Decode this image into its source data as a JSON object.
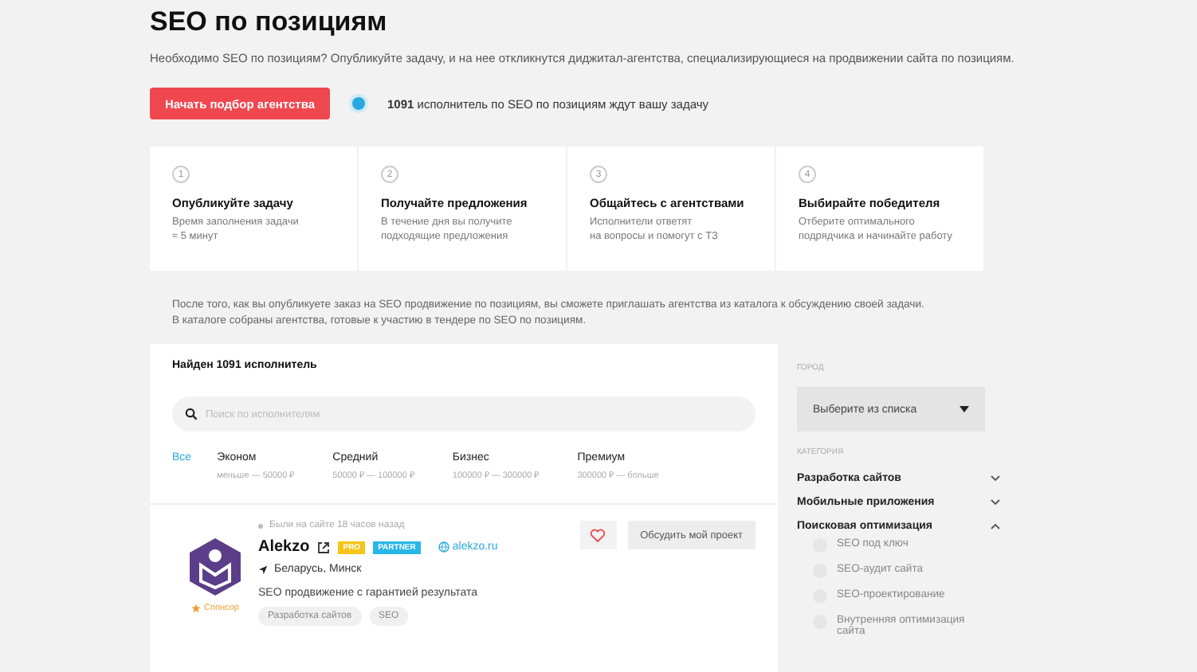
{
  "title": "SEO по позициям",
  "subtitle": "Необходимо SEO по позициям? Опубликуйте задачу, и на нее откликнутся диджитал-агентства, специализирующиеся на продвижении сайта по позициям.",
  "cta": {
    "button": "Начать подбор агентства",
    "count": "1091",
    "text": "исполнитель по SEO по позициям ждут вашу задачу"
  },
  "steps": [
    {
      "number": "1",
      "title": "Опубликуйте задачу",
      "lines": [
        "Время заполнения задачи",
        "≈ 5 минут"
      ]
    },
    {
      "number": "2",
      "title": "Получайте предложения",
      "lines": [
        "В течение дня вы получите",
        "подходящие предложения"
      ]
    },
    {
      "number": "3",
      "title": "Общайтесь с агентствами",
      "lines": [
        "Исполнители ответят",
        "на вопросы и помогут с ТЗ"
      ]
    },
    {
      "number": "4",
      "title": "Выбирайте победителя",
      "lines": [
        "Отберите оптимального",
        "подрядчика и начинайте работу"
      ]
    }
  ],
  "info": [
    "После того, как вы опубликуете заказ на SEO продвижение по позициям, вы сможете приглашать агентства из каталога к обсуждению своей задачи.",
    "В каталоге собраны агентства, готовые к участию в тендере по SEO по позициям."
  ],
  "results": {
    "found": "Найден 1091 исполнитель",
    "search": {
      "placeholder": "Поиск по исполнителям"
    },
    "price_filters": [
      {
        "label": "Все",
        "selected": true
      },
      {
        "label": "Эконом",
        "range": "меньше — 50000 ₽",
        "selected": false
      },
      {
        "label": "Средний",
        "range": "50000 ₽ — 100000 ₽",
        "selected": false
      },
      {
        "label": "Бизнес",
        "range": "100000 ₽ — 300000 ₽",
        "selected": false
      },
      {
        "label": "Премиум",
        "range": "300000 ₽ — больше",
        "selected": false
      }
    ]
  },
  "agency": {
    "last_seen": "Были на сайте 18 часов назад",
    "name": "Alekzo",
    "badges": [
      "PRO",
      "PARTNER"
    ],
    "site": "alekzo.ru",
    "location": "Беларусь, Минск",
    "sponsor": "Спонсор",
    "description": "SEO продвижение с гарантией результата",
    "tags": [
      "Разработка сайтов",
      "SEO"
    ],
    "favorite": false,
    "action": "Обсудить мой проект"
  },
  "sidebar": {
    "city_label": "ГОРОД",
    "city_select": "Выберите из списка",
    "category_label": "КАТЕГОРИЯ",
    "categories": [
      {
        "label": "Разработка сайтов",
        "expanded": false
      },
      {
        "label": "Мобильные приложения",
        "expanded": false
      },
      {
        "label": "Поисковая оптимизация",
        "expanded": true,
        "children": [
          {
            "label": "SEO под ключ",
            "checked": false
          },
          {
            "label": "SEO-аудит сайта",
            "checked": false
          },
          {
            "label": "SEO-проектирование",
            "checked": false
          },
          {
            "label": "Внутренняя оптимизация сайта",
            "checked": false
          }
        ]
      }
    ]
  }
}
